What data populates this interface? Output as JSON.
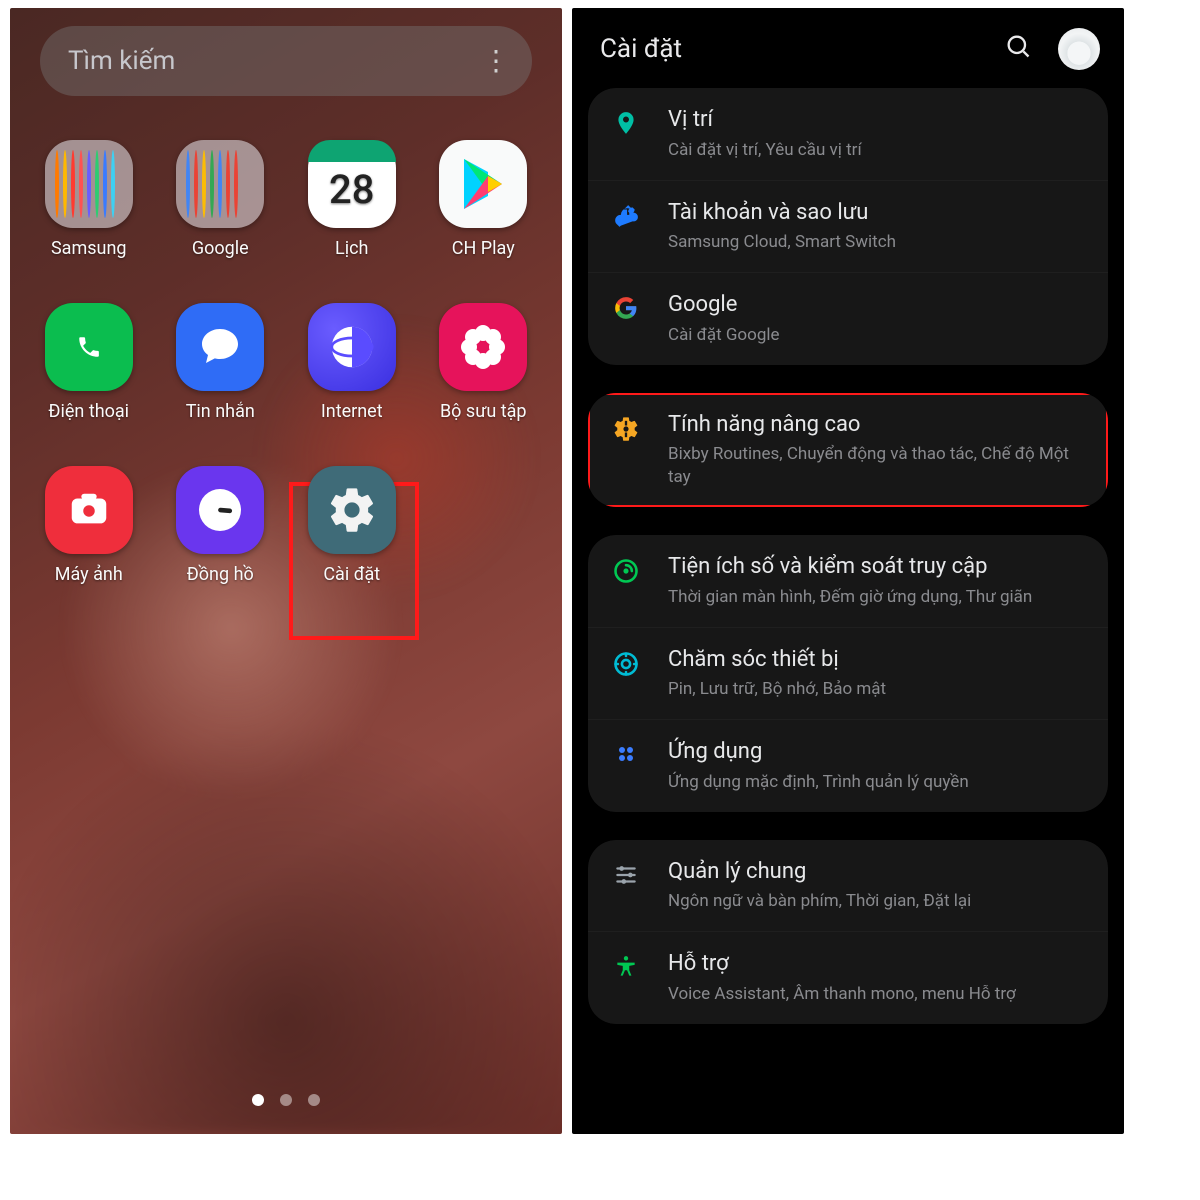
{
  "left": {
    "search_placeholder": "Tìm kiếm",
    "calendar_day": "28",
    "apps": {
      "samsung": "Samsung",
      "google": "Google",
      "calendar": "Lịch",
      "play": "CH Play",
      "phone": "Điện thoại",
      "messages": "Tin nhắn",
      "internet": "Internet",
      "gallery": "Bộ sưu tập",
      "camera": "Máy ảnh",
      "clock": "Đồng hồ",
      "settings": "Cài đặt"
    },
    "highlighted_app": "settings"
  },
  "right": {
    "header_title": "Cài đặt",
    "groups": [
      {
        "items": [
          {
            "id": "location",
            "title": "Vị trí",
            "sub": "Cài đặt vị trí, Yêu cầu vị trí",
            "color": "#00bfa5"
          },
          {
            "id": "accounts",
            "title": "Tài khoản và sao lưu",
            "sub": "Samsung Cloud, Smart Switch",
            "color": "#1e7bff"
          },
          {
            "id": "google",
            "title": "Google",
            "sub": "Cài đặt Google",
            "color": "#4285f4"
          }
        ]
      },
      {
        "highlight": true,
        "items": [
          {
            "id": "advanced",
            "title": "Tính năng nâng cao",
            "sub": "Bixby Routines, Chuyển động và thao tác, Chế độ Một tay",
            "color": "#f5a623"
          }
        ]
      },
      {
        "items": [
          {
            "id": "wellbeing",
            "title": "Tiện ích số và kiểm soát truy cập",
            "sub": "Thời gian màn hình, Đếm giờ ứng dụng, Thư giãn",
            "color": "#00c853"
          },
          {
            "id": "device",
            "title": "Chăm sóc thiết bị",
            "sub": "Pin, Lưu trữ, Bộ nhớ, Bảo mật",
            "color": "#00bcd4"
          },
          {
            "id": "apps",
            "title": "Ứng dụng",
            "sub": "Ứng dụng mặc định, Trình quản lý quyền",
            "color": "#3b7dff"
          }
        ]
      },
      {
        "items": [
          {
            "id": "general",
            "title": "Quản lý chung",
            "sub": "Ngôn ngữ và bàn phím, Thời gian, Đặt lại",
            "color": "#9aa3ab"
          },
          {
            "id": "access",
            "title": "Hỗ trợ",
            "sub": "Voice Assistant, Âm thanh mono, menu Hỗ trợ",
            "color": "#00c853"
          }
        ]
      }
    ]
  }
}
